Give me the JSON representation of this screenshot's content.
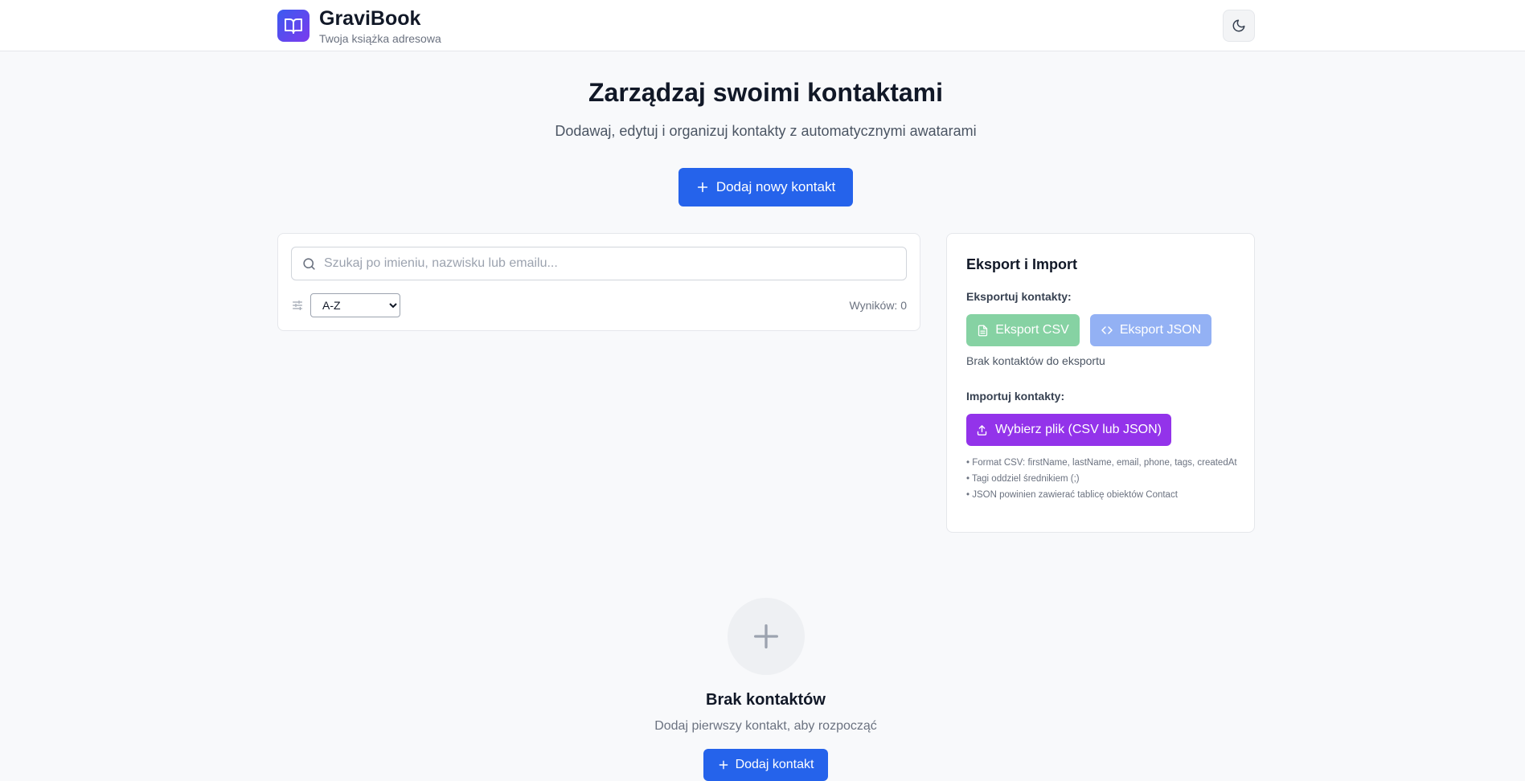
{
  "header": {
    "app_name": "GraviBook",
    "tagline": "Twoja książka adresowa",
    "logo_icon": "open-book-icon",
    "theme_toggle_icon": "moon-icon"
  },
  "hero": {
    "title": "Zarządzaj swoimi kontaktami",
    "subtitle": "Dodawaj, edytuj i organizuj kontakty z automatycznymi awatarami",
    "add_button_label": "Dodaj nowy kontakt"
  },
  "search": {
    "placeholder": "Szukaj po imieniu, nazwisku lub emailu...",
    "value": "",
    "sort_selected": "A-Z",
    "results_label": "Wyników: 0"
  },
  "export_import": {
    "title": "Eksport i Import",
    "export_label": "Eksportuj kontakty:",
    "csv_button": "Eksport CSV",
    "json_button": "Eksport JSON",
    "empty_text": "Brak kontaktów do eksportu",
    "import_label": "Importuj kontakty:",
    "import_button": "Wybierz plik (CSV lub JSON)",
    "notes": [
      "• Format CSV: firstName, lastName, email, phone, tags, createdAt",
      "• Tagi oddziel średnikiem (;)",
      "• JSON powinien zawierać tablicę obiektów Contact"
    ]
  },
  "empty_state": {
    "title": "Brak kontaktów",
    "subtitle": "Dodaj pierwszy kontakt, aby rozpocząć",
    "button_label": "Dodaj kontakt"
  },
  "colors": {
    "primary": "#2563eb",
    "csv_disabled": "#86d2a3",
    "json_disabled": "#93b1f4",
    "import": "#9333ea",
    "logo_gradient_start": "#3b5bf0",
    "logo_gradient_end": "#7c3aed"
  }
}
